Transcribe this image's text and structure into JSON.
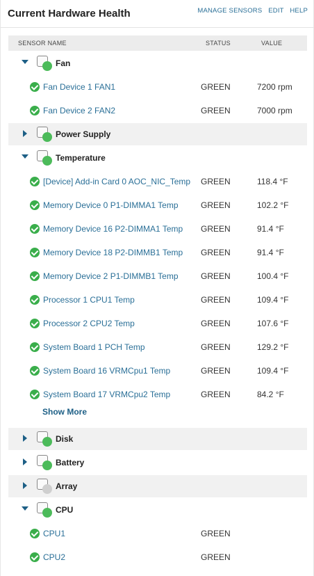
{
  "header": {
    "title": "Current Hardware Health",
    "links": [
      "MANAGE SENSORS",
      "EDIT",
      "HELP"
    ]
  },
  "columns": {
    "name": "SENSOR NAME",
    "status": "STATUS",
    "value": "VALUE"
  },
  "categories": {
    "fan": {
      "label": "Fan",
      "expanded": true,
      "icon": "fan-icon",
      "status_color": "#4cbb5a",
      "sensors": [
        {
          "name": "Fan Device 1 FAN1",
          "status": "GREEN",
          "value": "7200 rpm"
        },
        {
          "name": "Fan Device 2 FAN2",
          "status": "GREEN",
          "value": "7000 rpm"
        }
      ]
    },
    "power": {
      "label": "Power Supply",
      "expanded": false,
      "icon": "power-supply-icon",
      "status_color": "#4cbb5a"
    },
    "temperature": {
      "label": "Temperature",
      "expanded": true,
      "icon": "thermometer-icon",
      "status_color": "#4cbb5a",
      "sensors": [
        {
          "name": "[Device] Add-in Card 0 AOC_NIC_Temp",
          "status": "GREEN",
          "value": "118.4 °F"
        },
        {
          "name": "Memory Device 0 P1-DIMMA1 Temp",
          "status": "GREEN",
          "value": "102.2 °F"
        },
        {
          "name": "Memory Device 16 P2-DIMMA1 Temp",
          "status": "GREEN",
          "value": "91.4 °F"
        },
        {
          "name": "Memory Device 18 P2-DIMMB1 Temp",
          "status": "GREEN",
          "value": "91.4 °F"
        },
        {
          "name": "Memory Device 2 P1-DIMMB1 Temp",
          "status": "GREEN",
          "value": "100.4 °F"
        },
        {
          "name": "Processor 1 CPU1 Temp",
          "status": "GREEN",
          "value": "109.4 °F"
        },
        {
          "name": "Processor 2 CPU2 Temp",
          "status": "GREEN",
          "value": "107.6 °F"
        },
        {
          "name": "System Board 1 PCH Temp",
          "status": "GREEN",
          "value": "129.2 °F"
        },
        {
          "name": "System Board 16 VRMCpu1 Temp",
          "status": "GREEN",
          "value": "109.4 °F"
        },
        {
          "name": "System Board 17 VRMCpu2 Temp",
          "status": "GREEN",
          "value": "84.2 °F"
        }
      ],
      "show_more": "Show More"
    },
    "disk": {
      "label": "Disk",
      "expanded": false,
      "icon": "disk-icon",
      "status_color": "#4cbb5a"
    },
    "battery": {
      "label": "Battery",
      "expanded": false,
      "icon": "battery-icon",
      "status_color": "#4cbb5a"
    },
    "array": {
      "label": "Array",
      "expanded": false,
      "icon": "array-icon",
      "status_color": "#cfcfcf"
    },
    "cpu": {
      "label": "CPU",
      "expanded": true,
      "icon": "cpu-icon",
      "status_color": "#4cbb5a",
      "sensors": [
        {
          "name": "CPU1",
          "status": "GREEN",
          "value": ""
        },
        {
          "name": "CPU2",
          "status": "GREEN",
          "value": ""
        }
      ]
    }
  }
}
